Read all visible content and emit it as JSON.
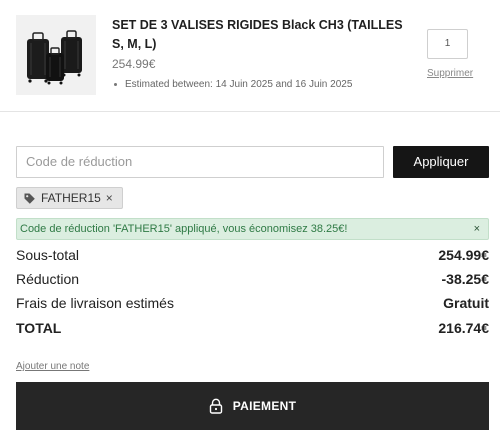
{
  "product": {
    "title": "SET DE 3 VALISES RIGIDES Black CH3 (TAILLES S, M, L)",
    "price": "254.99€",
    "eta": "Estimated between: 14 Juin 2025 and 16 Juin 2025",
    "quantity": "1",
    "remove_label": "Supprimer",
    "image_icon": "luggage-set-image"
  },
  "discount": {
    "placeholder": "Code de réduction",
    "apply_label": "Appliquer",
    "applied_code": "FATHER15",
    "remove_symbol": "×",
    "success_message": "Code de réduction 'FATHER15' appliqué, vous économisez 38.25€!",
    "close_symbol": "×"
  },
  "summary": {
    "subtotal_label": "Sous-total",
    "subtotal_value": "254.99€",
    "discount_label": "Réduction",
    "discount_value": "-38.25€",
    "shipping_label": "Frais de livraison estimés",
    "shipping_value": "Gratuit",
    "total_label": "TOTAL",
    "total_value": "216.74€"
  },
  "note_label": "Ajouter une note",
  "checkout_label": "PAIEMENT",
  "colors": {
    "button_dark": "#151515",
    "checkout_bg": "#262626",
    "success_bg": "#dbeee0",
    "success_text": "#2f7a45",
    "tag_bg": "#e6e6e6"
  }
}
